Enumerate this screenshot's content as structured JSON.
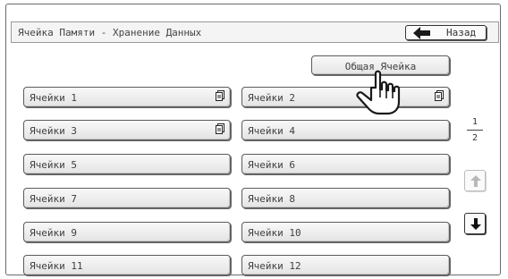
{
  "header": {
    "title": "Ячейка Памяти - Хранение Данных",
    "back_label": "Назад"
  },
  "common_box": {
    "label": "Общая Ячейка"
  },
  "boxes": [
    {
      "label": "Ячейки 1",
      "has_doc": true
    },
    {
      "label": "Ячейки 2",
      "has_doc": true
    },
    {
      "label": "Ячейки 3",
      "has_doc": true
    },
    {
      "label": "Ячейки 4",
      "has_doc": false
    },
    {
      "label": "Ячейки 5",
      "has_doc": false
    },
    {
      "label": "Ячейки 6",
      "has_doc": false
    },
    {
      "label": "Ячейки 7",
      "has_doc": false
    },
    {
      "label": "Ячейки 8",
      "has_doc": false
    },
    {
      "label": "Ячейки 9",
      "has_doc": false
    },
    {
      "label": "Ячейки 10",
      "has_doc": false
    },
    {
      "label": "Ячейки 11",
      "has_doc": false
    },
    {
      "label": "Ячейки 12",
      "has_doc": false
    }
  ],
  "pager": {
    "current": "1",
    "total": "2"
  },
  "icons": {
    "back": "left-arrow-icon",
    "document": "document-icon",
    "scroll_up": "up-arrow-icon",
    "scroll_down": "down-arrow-icon",
    "pointer": "hand-pointer-icon"
  }
}
